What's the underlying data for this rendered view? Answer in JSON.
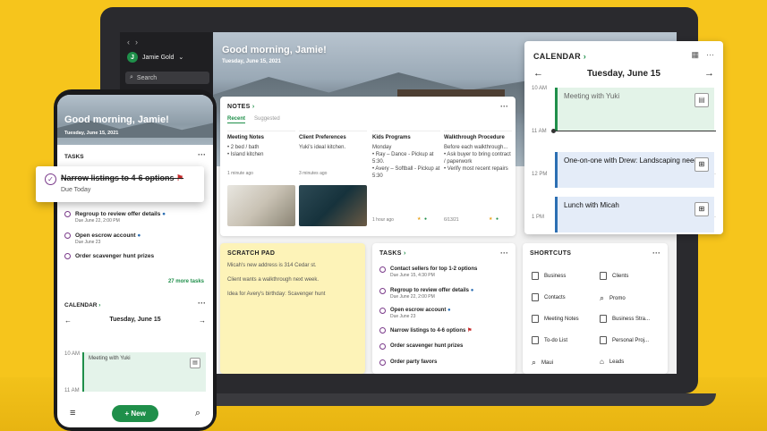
{
  "desktop": {
    "user_name": "Jamie Gold",
    "user_initial": "J",
    "search_label": "Search",
    "greeting": "Good morning, Jamie!",
    "date": "Tuesday, June 15, 2021",
    "notes": {
      "title": "NOTES",
      "tabs": [
        "Recent",
        "Suggested"
      ],
      "items": [
        {
          "title": "Meeting Notes",
          "body": [
            "• 2 bed / bath",
            "• Island kitchen"
          ],
          "meta": "1 minute ago"
        },
        {
          "title": "Client Preferences",
          "body": [
            "Yuki's ideal kitchen."
          ],
          "meta": "3 minutes ago"
        },
        {
          "title": "Kids Programs",
          "body": [
            "Monday",
            "• Ray – Dance - Pickup at 5:30.",
            "• Avery – Softball - Pickup at 5:30"
          ],
          "meta": "1 hour ago"
        },
        {
          "title": "Walkthrough Procedure",
          "body": [
            "Before each walkthrough...",
            "• Ask buyer to bring contract / paperwork",
            "• Verify most recent repairs"
          ],
          "meta": "6/13/21"
        }
      ]
    },
    "scratch": {
      "title": "SCRATCH PAD",
      "lines": [
        "Micah's new address is 314 Cedar st.",
        "Client wants a walkthrough next week.",
        "Idea for Avery's birthday: Scavenger hunt"
      ]
    },
    "tasks": {
      "title": "TASKS",
      "items": [
        {
          "title": "Contact sellers for top 1-2 options",
          "due": "Due June 15, 4:30 PM"
        },
        {
          "title": "Regroup to review offer details",
          "due": "Due June 22, 2:00 PM"
        },
        {
          "title": "Open escrow account",
          "due": "Due June 23"
        },
        {
          "title": "Narrow listings to 4-6 options",
          "due": ""
        },
        {
          "title": "Order scavenger hunt prizes",
          "due": ""
        },
        {
          "title": "Order party favors",
          "due": ""
        }
      ]
    },
    "shortcuts": {
      "title": "SHORTCUTS",
      "items": [
        "Business",
        "Clients",
        "Contacts",
        "Promo",
        "Meeting Notes",
        "Business Stra...",
        "To-do List",
        "Personal Proj...",
        "Maui",
        "Leads"
      ]
    }
  },
  "calendar": {
    "title": "CALENDAR",
    "date": "Tuesday, June 15",
    "hours": [
      "10 AM",
      "11 AM",
      "12 PM",
      "1 PM"
    ],
    "events": [
      {
        "title": "Meeting with Yuki"
      },
      {
        "title": "One-on-one with Drew: Landscaping needs"
      },
      {
        "title": "Lunch with Micah"
      }
    ]
  },
  "phone": {
    "greeting": "Good morning, Jamie!",
    "date": "Tuesday, June 15, 2021",
    "tasks_title": "TASKS",
    "popout": {
      "title": "Narrow listings to 4-6 options",
      "due": "Due Today"
    },
    "tasks": [
      {
        "title": "Regroup to review offer details",
        "due": "Due June 22, 2:00 PM"
      },
      {
        "title": "Open escrow account",
        "due": "Due June 23"
      },
      {
        "title": "Order scavenger hunt prizes",
        "due": ""
      }
    ],
    "more_tasks": "27 more tasks",
    "calendar_title": "CALENDAR",
    "calendar_date": "Tuesday, June 15",
    "hours": [
      "10 AM",
      "11 AM"
    ],
    "event": "Meeting with Yuki",
    "new_label": "+ New"
  },
  "colors": {
    "accent": "#1f8f4a",
    "background": "#f6c51c",
    "task_circle": "#7a3a8a"
  }
}
